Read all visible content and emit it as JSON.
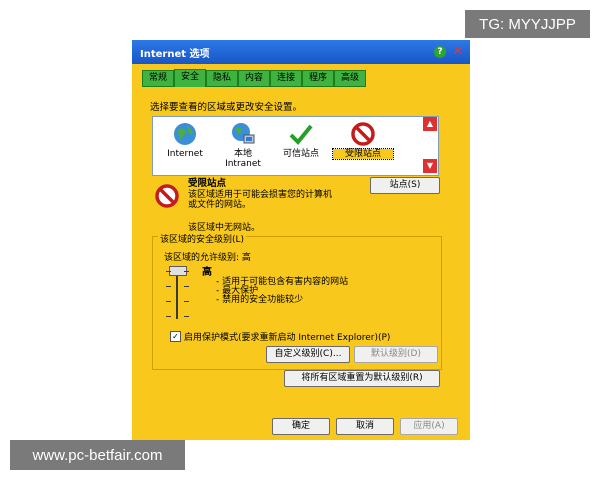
{
  "watermarks": {
    "top_right": "TG: MYYJJPP",
    "bottom_left": "www.pc-betfair.com"
  },
  "window": {
    "title": "Internet 选项"
  },
  "tabs": [
    {
      "label": "常规"
    },
    {
      "label": "安全"
    },
    {
      "label": "隐私"
    },
    {
      "label": "内容"
    },
    {
      "label": "连接"
    },
    {
      "label": "程序"
    },
    {
      "label": "高级"
    }
  ],
  "active_tab": "安全",
  "zone_prompt": "选择要查看的区域或更改安全设置。",
  "zones": [
    {
      "label": "Internet",
      "icon": "globe-icon"
    },
    {
      "label": "本地\nIntranet",
      "icon": "intranet-icon"
    },
    {
      "label": "可信站点",
      "icon": "checkmark-icon"
    },
    {
      "label": "受限站点",
      "icon": "restricted-icon"
    }
  ],
  "selected_zone": "受限站点",
  "zone_info": {
    "title": "受限站点",
    "description": "该区域适用于可能会损害您的计算机或文件的网站。",
    "no_sites": "该区域中无网站。",
    "sites_button": "站点(S)"
  },
  "security_level": {
    "group_label": "该区域的安全级别(L)",
    "allowed_text": "该区域的允许级别: 高",
    "level_name": "高",
    "level_value": "高",
    "items": [
      "适用于可能包含有害内容的网站",
      "最大保护",
      "禁用的安全功能较少"
    ]
  },
  "protected_mode": {
    "checked": true,
    "label": "启用保护模式(要求重新启动 Internet Explorer)(P)"
  },
  "buttons": {
    "custom_level": "自定义级别(C)...",
    "default_level": "默认级别(D)",
    "reset_all": "将所有区域重置为默认级别(R)",
    "ok": "确定",
    "cancel": "取消",
    "apply": "应用(A)"
  },
  "colors": {
    "dialog_bg": "#f8c81c",
    "tab_bg": "#3fb33f",
    "titlebar": "#1856c8",
    "scroll_arrows": "#e03030"
  }
}
